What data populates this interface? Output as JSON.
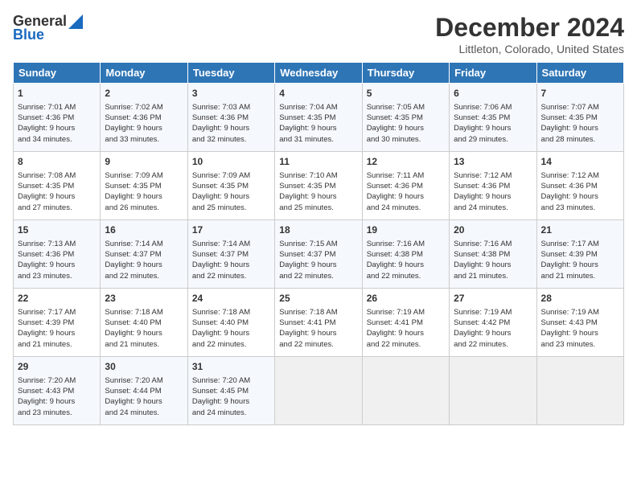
{
  "header": {
    "logo_line1": "General",
    "logo_line2": "Blue",
    "month": "December 2024",
    "location": "Littleton, Colorado, United States"
  },
  "days_of_week": [
    "Sunday",
    "Monday",
    "Tuesday",
    "Wednesday",
    "Thursday",
    "Friday",
    "Saturday"
  ],
  "weeks": [
    [
      {
        "day": "1",
        "info": "Sunrise: 7:01 AM\nSunset: 4:36 PM\nDaylight: 9 hours\nand 34 minutes."
      },
      {
        "day": "2",
        "info": "Sunrise: 7:02 AM\nSunset: 4:36 PM\nDaylight: 9 hours\nand 33 minutes."
      },
      {
        "day": "3",
        "info": "Sunrise: 7:03 AM\nSunset: 4:36 PM\nDaylight: 9 hours\nand 32 minutes."
      },
      {
        "day": "4",
        "info": "Sunrise: 7:04 AM\nSunset: 4:35 PM\nDaylight: 9 hours\nand 31 minutes."
      },
      {
        "day": "5",
        "info": "Sunrise: 7:05 AM\nSunset: 4:35 PM\nDaylight: 9 hours\nand 30 minutes."
      },
      {
        "day": "6",
        "info": "Sunrise: 7:06 AM\nSunset: 4:35 PM\nDaylight: 9 hours\nand 29 minutes."
      },
      {
        "day": "7",
        "info": "Sunrise: 7:07 AM\nSunset: 4:35 PM\nDaylight: 9 hours\nand 28 minutes."
      }
    ],
    [
      {
        "day": "8",
        "info": "Sunrise: 7:08 AM\nSunset: 4:35 PM\nDaylight: 9 hours\nand 27 minutes."
      },
      {
        "day": "9",
        "info": "Sunrise: 7:09 AM\nSunset: 4:35 PM\nDaylight: 9 hours\nand 26 minutes."
      },
      {
        "day": "10",
        "info": "Sunrise: 7:09 AM\nSunset: 4:35 PM\nDaylight: 9 hours\nand 25 minutes."
      },
      {
        "day": "11",
        "info": "Sunrise: 7:10 AM\nSunset: 4:35 PM\nDaylight: 9 hours\nand 25 minutes."
      },
      {
        "day": "12",
        "info": "Sunrise: 7:11 AM\nSunset: 4:36 PM\nDaylight: 9 hours\nand 24 minutes."
      },
      {
        "day": "13",
        "info": "Sunrise: 7:12 AM\nSunset: 4:36 PM\nDaylight: 9 hours\nand 24 minutes."
      },
      {
        "day": "14",
        "info": "Sunrise: 7:12 AM\nSunset: 4:36 PM\nDaylight: 9 hours\nand 23 minutes."
      }
    ],
    [
      {
        "day": "15",
        "info": "Sunrise: 7:13 AM\nSunset: 4:36 PM\nDaylight: 9 hours\nand 23 minutes."
      },
      {
        "day": "16",
        "info": "Sunrise: 7:14 AM\nSunset: 4:37 PM\nDaylight: 9 hours\nand 22 minutes."
      },
      {
        "day": "17",
        "info": "Sunrise: 7:14 AM\nSunset: 4:37 PM\nDaylight: 9 hours\nand 22 minutes."
      },
      {
        "day": "18",
        "info": "Sunrise: 7:15 AM\nSunset: 4:37 PM\nDaylight: 9 hours\nand 22 minutes."
      },
      {
        "day": "19",
        "info": "Sunrise: 7:16 AM\nSunset: 4:38 PM\nDaylight: 9 hours\nand 22 minutes."
      },
      {
        "day": "20",
        "info": "Sunrise: 7:16 AM\nSunset: 4:38 PM\nDaylight: 9 hours\nand 21 minutes."
      },
      {
        "day": "21",
        "info": "Sunrise: 7:17 AM\nSunset: 4:39 PM\nDaylight: 9 hours\nand 21 minutes."
      }
    ],
    [
      {
        "day": "22",
        "info": "Sunrise: 7:17 AM\nSunset: 4:39 PM\nDaylight: 9 hours\nand 21 minutes."
      },
      {
        "day": "23",
        "info": "Sunrise: 7:18 AM\nSunset: 4:40 PM\nDaylight: 9 hours\nand 21 minutes."
      },
      {
        "day": "24",
        "info": "Sunrise: 7:18 AM\nSunset: 4:40 PM\nDaylight: 9 hours\nand 22 minutes."
      },
      {
        "day": "25",
        "info": "Sunrise: 7:18 AM\nSunset: 4:41 PM\nDaylight: 9 hours\nand 22 minutes."
      },
      {
        "day": "26",
        "info": "Sunrise: 7:19 AM\nSunset: 4:41 PM\nDaylight: 9 hours\nand 22 minutes."
      },
      {
        "day": "27",
        "info": "Sunrise: 7:19 AM\nSunset: 4:42 PM\nDaylight: 9 hours\nand 22 minutes."
      },
      {
        "day": "28",
        "info": "Sunrise: 7:19 AM\nSunset: 4:43 PM\nDaylight: 9 hours\nand 23 minutes."
      }
    ],
    [
      {
        "day": "29",
        "info": "Sunrise: 7:20 AM\nSunset: 4:43 PM\nDaylight: 9 hours\nand 23 minutes."
      },
      {
        "day": "30",
        "info": "Sunrise: 7:20 AM\nSunset: 4:44 PM\nDaylight: 9 hours\nand 24 minutes."
      },
      {
        "day": "31",
        "info": "Sunrise: 7:20 AM\nSunset: 4:45 PM\nDaylight: 9 hours\nand 24 minutes."
      },
      null,
      null,
      null,
      null
    ]
  ]
}
